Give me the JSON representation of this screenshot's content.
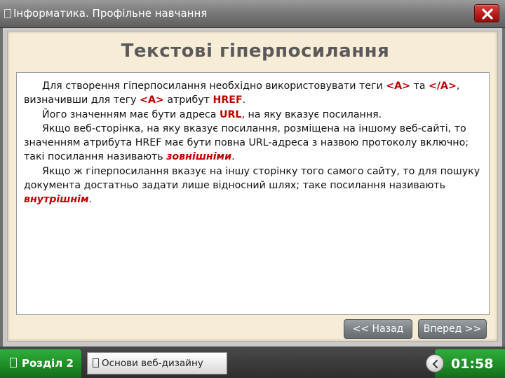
{
  "window": {
    "title": "Інформатика. Профільне навчання",
    "close_icon": "close-x-icon"
  },
  "slide": {
    "heading": "Текстові гіперпосилання",
    "p1": {
      "a": "Для створення гіперпосилання необхідно використовувати теги ",
      "b": "<A>",
      "c": " та ",
      "d": "</A>",
      "e": ", визначивши для тегу ",
      "f": "<A>",
      "g": " атрибут ",
      "h": "HREF",
      "i": "."
    },
    "p2": {
      "a": "Його значенням має бути адреса ",
      "b": "URL",
      "c": ", на яку вказує посилання."
    },
    "p3": {
      "a": "Якщо веб-сторінка, на яку вказує посилання, розміщена на іншому веб-сайті, то значенням атрибута HREF має бути повна URL-адреса з назвою протоколу включно; такі посилання називають ",
      "b": "зовнішніми",
      "c": "."
    },
    "p4": {
      "a": "Якщо ж гіперпосилання вказує на іншу сторінку того самого сайту, то для пошуку документа достатньо задати лише відносний шлях; таке посилання називають ",
      "b": "внутрішнім",
      "c": "."
    }
  },
  "nav": {
    "back_label": "<< Назад",
    "next_label": "Вперед >>"
  },
  "footer": {
    "section_label": "Розділ 2",
    "topic_label": "Основи веб-дизайну",
    "timer": "01:58",
    "timer_icon": "back-arrow-icon"
  },
  "colors": {
    "accent_green": "#1d8a26",
    "highlight_red": "#c00000",
    "close_red": "#b51e1b"
  }
}
